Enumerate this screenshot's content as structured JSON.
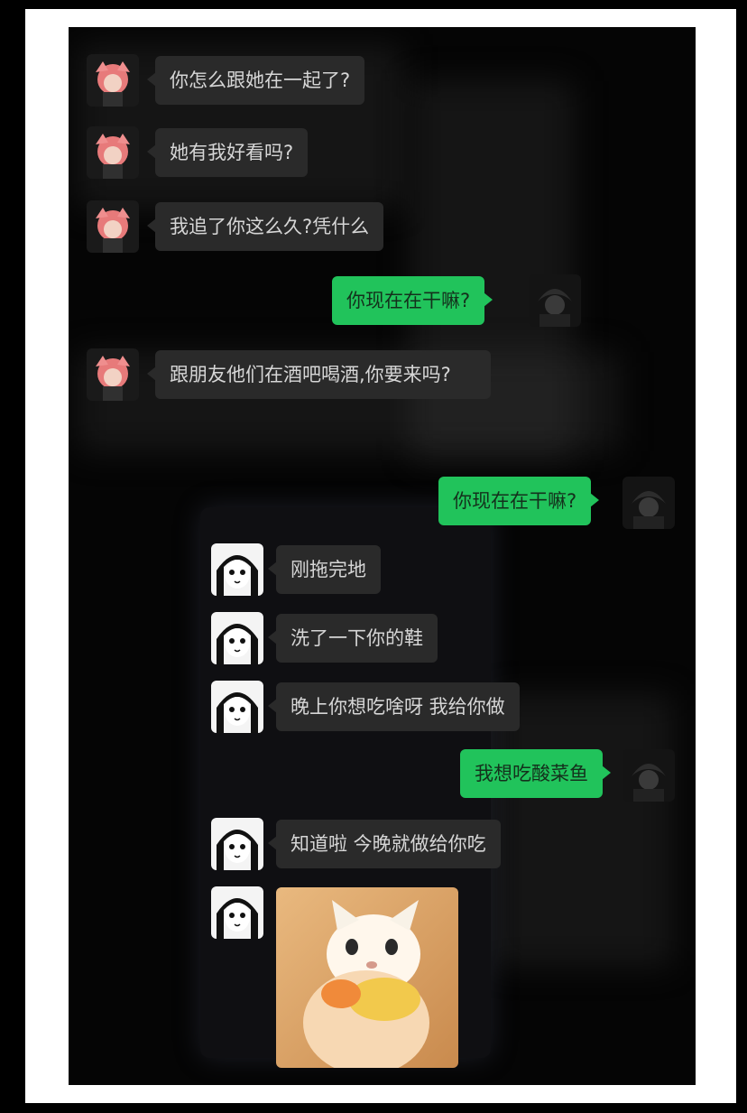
{
  "colors": {
    "outer_background": "#000000",
    "paper": "#ffffff",
    "chat_background": "#050505",
    "incoming_bubble": "#2a2a2a",
    "outgoing_bubble": "#21c35b"
  },
  "section1": {
    "messages": [
      {
        "side": "left",
        "avatar": "pink-hair-girl-avatar",
        "text": "你怎么跟她在一起了?"
      },
      {
        "side": "left",
        "avatar": "pink-hair-girl-avatar",
        "text": "她有我好看吗?"
      },
      {
        "side": "left",
        "avatar": "pink-hair-girl-avatar",
        "text": "我追了你这么久?凭什么"
      },
      {
        "side": "right",
        "avatar": "dark-hair-boy-avatar",
        "text": "你现在在干嘛?"
      },
      {
        "side": "left",
        "avatar": "pink-hair-girl-avatar",
        "text": "跟朋友他们在酒吧喝酒,你要来吗?"
      }
    ]
  },
  "section2": {
    "messages": [
      {
        "side": "right",
        "avatar": "dark-hair-boy-avatar",
        "text": "你现在在干嘛?"
      },
      {
        "side": "left",
        "avatar": "manga-girl-avatar",
        "text": "刚拖完地"
      },
      {
        "side": "left",
        "avatar": "manga-girl-avatar",
        "text": "洗了一下你的鞋"
      },
      {
        "side": "left",
        "avatar": "manga-girl-avatar",
        "text": "晚上你想吃啥呀 我给你做"
      },
      {
        "side": "right",
        "avatar": "dark-hair-boy-avatar",
        "text": "我想吃酸菜鱼"
      },
      {
        "side": "left",
        "avatar": "manga-girl-avatar",
        "text": "知道啦 今晚就做给你吃"
      },
      {
        "side": "left",
        "avatar": "manga-girl-avatar",
        "image": "cat-photo"
      }
    ]
  }
}
